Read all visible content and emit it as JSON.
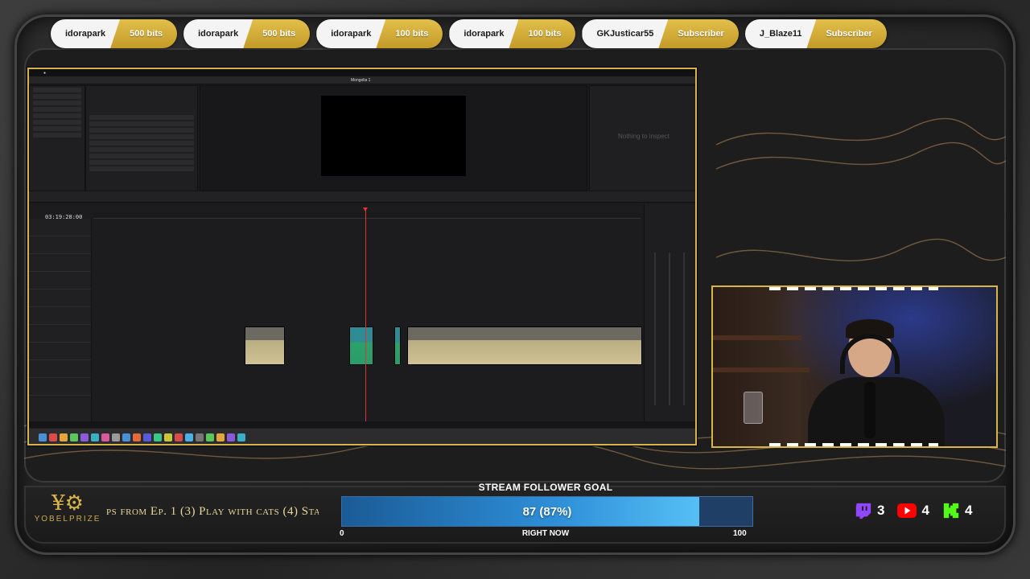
{
  "alerts": [
    {
      "user": "idorapark",
      "amount": "500 bits"
    },
    {
      "user": "idorapark",
      "amount": "500 bits"
    },
    {
      "user": "idorapark",
      "amount": "100 bits"
    },
    {
      "user": "idorapark",
      "amount": "100 bits"
    },
    {
      "user": "GKJusticar55",
      "amount": "Subscriber"
    },
    {
      "user": "J_Blaze11",
      "amount": "Subscriber"
    }
  ],
  "editor": {
    "project_title": "Mongolia 1",
    "timecode": "03:19:28:00",
    "inspector_message": "Nothing to inspect"
  },
  "branding": {
    "logo_name": "YOBELPRIZE"
  },
  "ticker": {
    "text": "ps from Ep. 1 (3) Play with cats (4) Sta"
  },
  "goal": {
    "title": "STREAM FOLLOWER GOAL",
    "value_text": "87 (87%)",
    "progress": 0.87,
    "min": "0",
    "max": "100",
    "subtitle": "RIGHT NOW"
  },
  "socials": [
    {
      "icon": "twitch-icon",
      "count": "3",
      "color": "#9146ff"
    },
    {
      "icon": "youtube-icon",
      "count": "4",
      "color": "#ff0000"
    },
    {
      "icon": "kick-icon",
      "count": "4",
      "color": "#53fc18"
    }
  ]
}
